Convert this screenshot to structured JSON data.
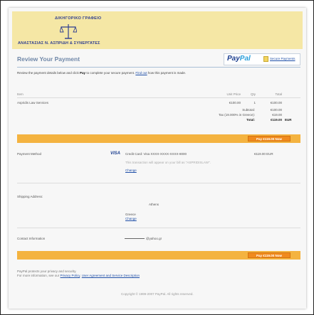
{
  "banner": {
    "firm_line1": "ΔΙΚΗΓΟΡΙΚΟ ΓΡΑΦΕΙΟ",
    "firm_line2": "ΑΝΑΣΤΑΣΙΑΣ Ν. ΑΣΠΡΙΔΗ & ΣΥΝΕΡΓΑΤΕΣ"
  },
  "header": {
    "title": "Review Your Payment",
    "paypal_pay": "Pay",
    "paypal_pal": "Pal",
    "secure_link": "Secure Payments"
  },
  "intro": {
    "text1": "Review the payment details below and click ",
    "pay_word": "Pay",
    "text2": " to complete your secure payment. ",
    "find_out": "Find out",
    "text3": " how this payment is made."
  },
  "table": {
    "headers": {
      "item": "Item",
      "unit_price": "Unit Price",
      "qty": "Qty",
      "total": "Total"
    },
    "rows": [
      {
        "item": "Aspridis Law Services",
        "unit_price": "€100.00",
        "qty": "1",
        "total": "€100.00"
      }
    ],
    "subtotal_label": "Subtotal:",
    "subtotal_value": "€100.00",
    "tax_label": "Tax (19.000% in Greece):",
    "tax_value": "€19.00",
    "total_label": "Total:",
    "total_value": "€119.00",
    "currency": "EUR"
  },
  "pay_button_label": "Pay €119.00 Now",
  "payment_method": {
    "label": "Payment Method",
    "card_brand": "VISA",
    "card": "Credit Card: Visa XXXX-XXXX-XXXX-8000",
    "amount": "€119.00 EUR",
    "note": "This transaction will appear on your bill as \"ASPRIDISLAW\".",
    "change": "Change"
  },
  "shipping": {
    "label": "Shipping Address:",
    "city": "Athens",
    "country": "Greece",
    "change": "Change"
  },
  "contact": {
    "label": "Contact Information",
    "email": "@yahoo.gr"
  },
  "footer": {
    "line1": "PayPal protects your privacy and security.",
    "line2_prefix": "For more information, see our ",
    "privacy": "Privacy Policy",
    "sep": ", ",
    "agreement": "User Agreement and Service Description",
    "copyright": "Copyright © 1999-2007 PayPal. All rights reserved."
  },
  "colors": {
    "banner_bg": "#f5e7a5",
    "title_blue": "#6f87a8",
    "orange_bar": "#f4b340",
    "pay_button": "#f08a1e",
    "link": "#1f4fa8"
  }
}
